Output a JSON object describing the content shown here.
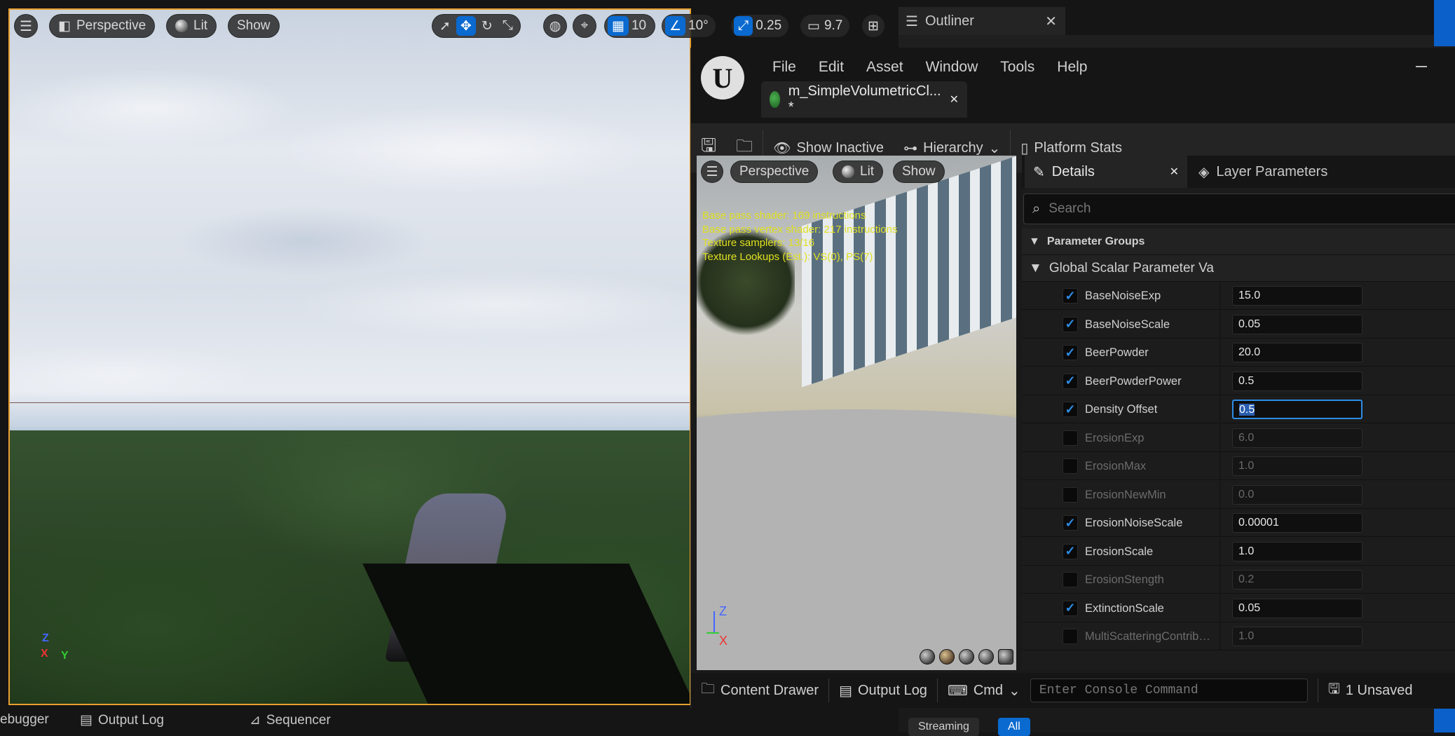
{
  "main_viewport": {
    "view_mode": "Perspective",
    "lighting": "Lit",
    "show": "Show",
    "grid_snap": "10",
    "rotation_snap": "10°",
    "scale_snap": "0.25",
    "camera_speed": "9.7",
    "axis": {
      "x": "X",
      "y": "Y",
      "z": "Z"
    }
  },
  "outliner": {
    "title": "Outliner"
  },
  "material_editor": {
    "menu": [
      "File",
      "Edit",
      "Asset",
      "Window",
      "Tools",
      "Help"
    ],
    "asset_tab": "m_SimpleVolumetricCl... *",
    "toolbar": {
      "show_inactive": "Show Inactive",
      "hierarchy": "Hierarchy",
      "platform_stats": "Platform Stats"
    },
    "preview": {
      "view_mode": "Perspective",
      "lighting": "Lit",
      "show": "Show",
      "stats": [
        "Base pass shader: 169 instructions",
        "Base pass vertex shader: 217 instructions",
        "Texture samplers: 13/16",
        "Texture Lookups (Est.): VS(0), PS(7)"
      ],
      "axis": {
        "x": "X",
        "z": "Z"
      }
    },
    "details": {
      "tab_details": "Details",
      "tab_layer_parameters": "Layer Parameters",
      "search_placeholder": "Search",
      "group_header": "Parameter Groups",
      "subgroup": "Global Scalar Parameter Va",
      "params": [
        {
          "name": "BaseNoiseExp",
          "value": "15.0",
          "enabled": true
        },
        {
          "name": "BaseNoiseScale",
          "value": "0.05",
          "enabled": true
        },
        {
          "name": "BeerPowder",
          "value": "20.0",
          "enabled": true
        },
        {
          "name": "BeerPowderPower",
          "value": "0.5",
          "enabled": true
        },
        {
          "name": "Density Offset",
          "value": "0.5",
          "enabled": true
        },
        {
          "name": "ErosionExp",
          "value": "6.0",
          "enabled": false
        },
        {
          "name": "ErosionMax",
          "value": "1.0",
          "enabled": false
        },
        {
          "name": "ErosionNewMin",
          "value": "0.0",
          "enabled": false
        },
        {
          "name": "ErosionNoiseScale",
          "value": "0.00001",
          "enabled": true
        },
        {
          "name": "ErosionScale",
          "value": "1.0",
          "enabled": true
        },
        {
          "name": "ErosionStength",
          "value": "0.2",
          "enabled": false
        },
        {
          "name": "ExtinctionScale",
          "value": "0.05",
          "enabled": true
        },
        {
          "name": "MultiScatteringContribut...",
          "value": "1.0",
          "enabled": false
        }
      ]
    },
    "status": {
      "content_drawer": "Content Drawer",
      "output_log": "Output Log",
      "cmd": "Cmd",
      "console_placeholder": "Enter Console Command",
      "unsaved": "1 Unsaved"
    }
  },
  "bottom_tabs": {
    "debugger": "ebugger",
    "output_log": "Output Log",
    "sequencer": "Sequencer",
    "streaming": "Streaming",
    "all": "All"
  },
  "colors": {
    "accent": "#0a6ad0",
    "check": "#2d8de6",
    "stats_text": "#e0e020",
    "selection_border": "#e8a030"
  }
}
